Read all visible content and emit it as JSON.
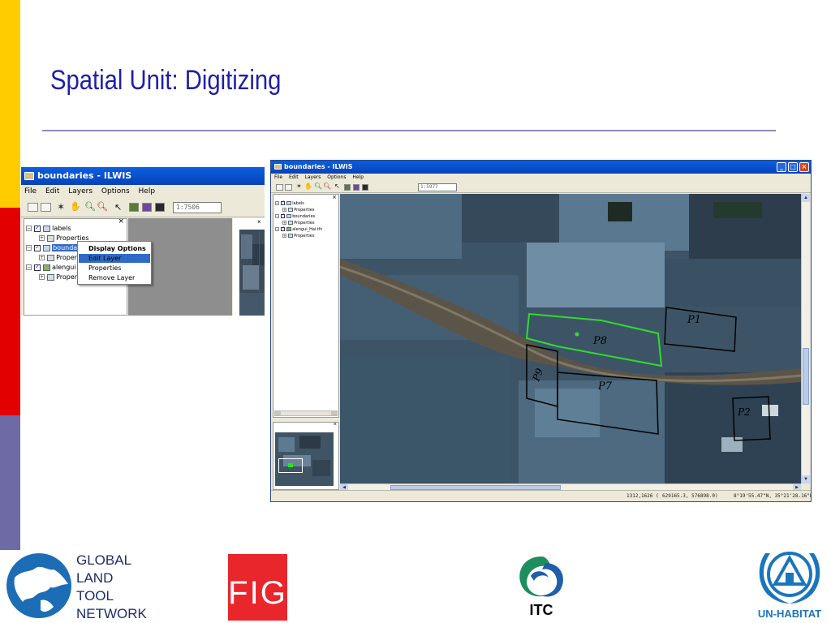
{
  "slide": {
    "title": "Spatial Unit: Digitizing",
    "colors": {
      "bar_yellow": "#FFCC00",
      "bar_red": "#E20000",
      "bar_slate": "#6D6AA6",
      "title": "#1F1FA8"
    }
  },
  "small_window": {
    "title": "boundaries - ILWIS",
    "icon": "ilwis-app-icon",
    "menu": [
      "File",
      "Edit",
      "Layers",
      "Options",
      "Help"
    ],
    "scale": "1:7506",
    "tree": [
      {
        "label": "labels",
        "checked": true
      },
      {
        "label": "Properties"
      },
      {
        "label": "bounda",
        "checked": true,
        "selected": true
      },
      {
        "label": "Proper"
      },
      {
        "label": "alengui",
        "checked": true
      },
      {
        "label": "Proper"
      }
    ],
    "close_glyph": "×"
  },
  "context_menu": {
    "items": [
      "Display Options",
      "Edit Layer",
      "Properties",
      "Remove Layer"
    ],
    "highlighted": "Edit Layer"
  },
  "big_window": {
    "title": "boundaries - ILWIS",
    "menu": [
      "File",
      "Edit",
      "Layers",
      "Options",
      "Help"
    ],
    "scale": "1:5977",
    "tree": [
      {
        "label": "labels",
        "checked": true
      },
      {
        "label": "Properties"
      },
      {
        "label": "boundaries",
        "checked": true
      },
      {
        "label": "Properties"
      },
      {
        "label": "alengui_Hai.tfc",
        "checked": true
      },
      {
        "label": "Properties"
      }
    ],
    "close_glyph": "×",
    "controls": {
      "minimize": "_",
      "maximize": "□",
      "close": "×"
    },
    "status": {
      "pixel": "1312,1626 (",
      "coords": "629165.3,  576898.0)",
      "latlon": "8°19'55.47\"N, 35°21'28.16\"E"
    },
    "map_labels": [
      "P1",
      "P8",
      "P7",
      "P2",
      "P9"
    ]
  },
  "logos": {
    "gltn": {
      "lines": [
        "GLOBAL",
        "LAND",
        "TOOL",
        "NETWORK"
      ],
      "icon": "globe-icon"
    },
    "fig": {
      "text": "FIG",
      "color": "#E8262C"
    },
    "itc": {
      "text": "ITC",
      "icon": "itc-swirl-icon"
    },
    "unhabitat": {
      "text": "UN-HABITAT",
      "color": "#1B75BC",
      "icon": "un-emblem-icon"
    }
  }
}
